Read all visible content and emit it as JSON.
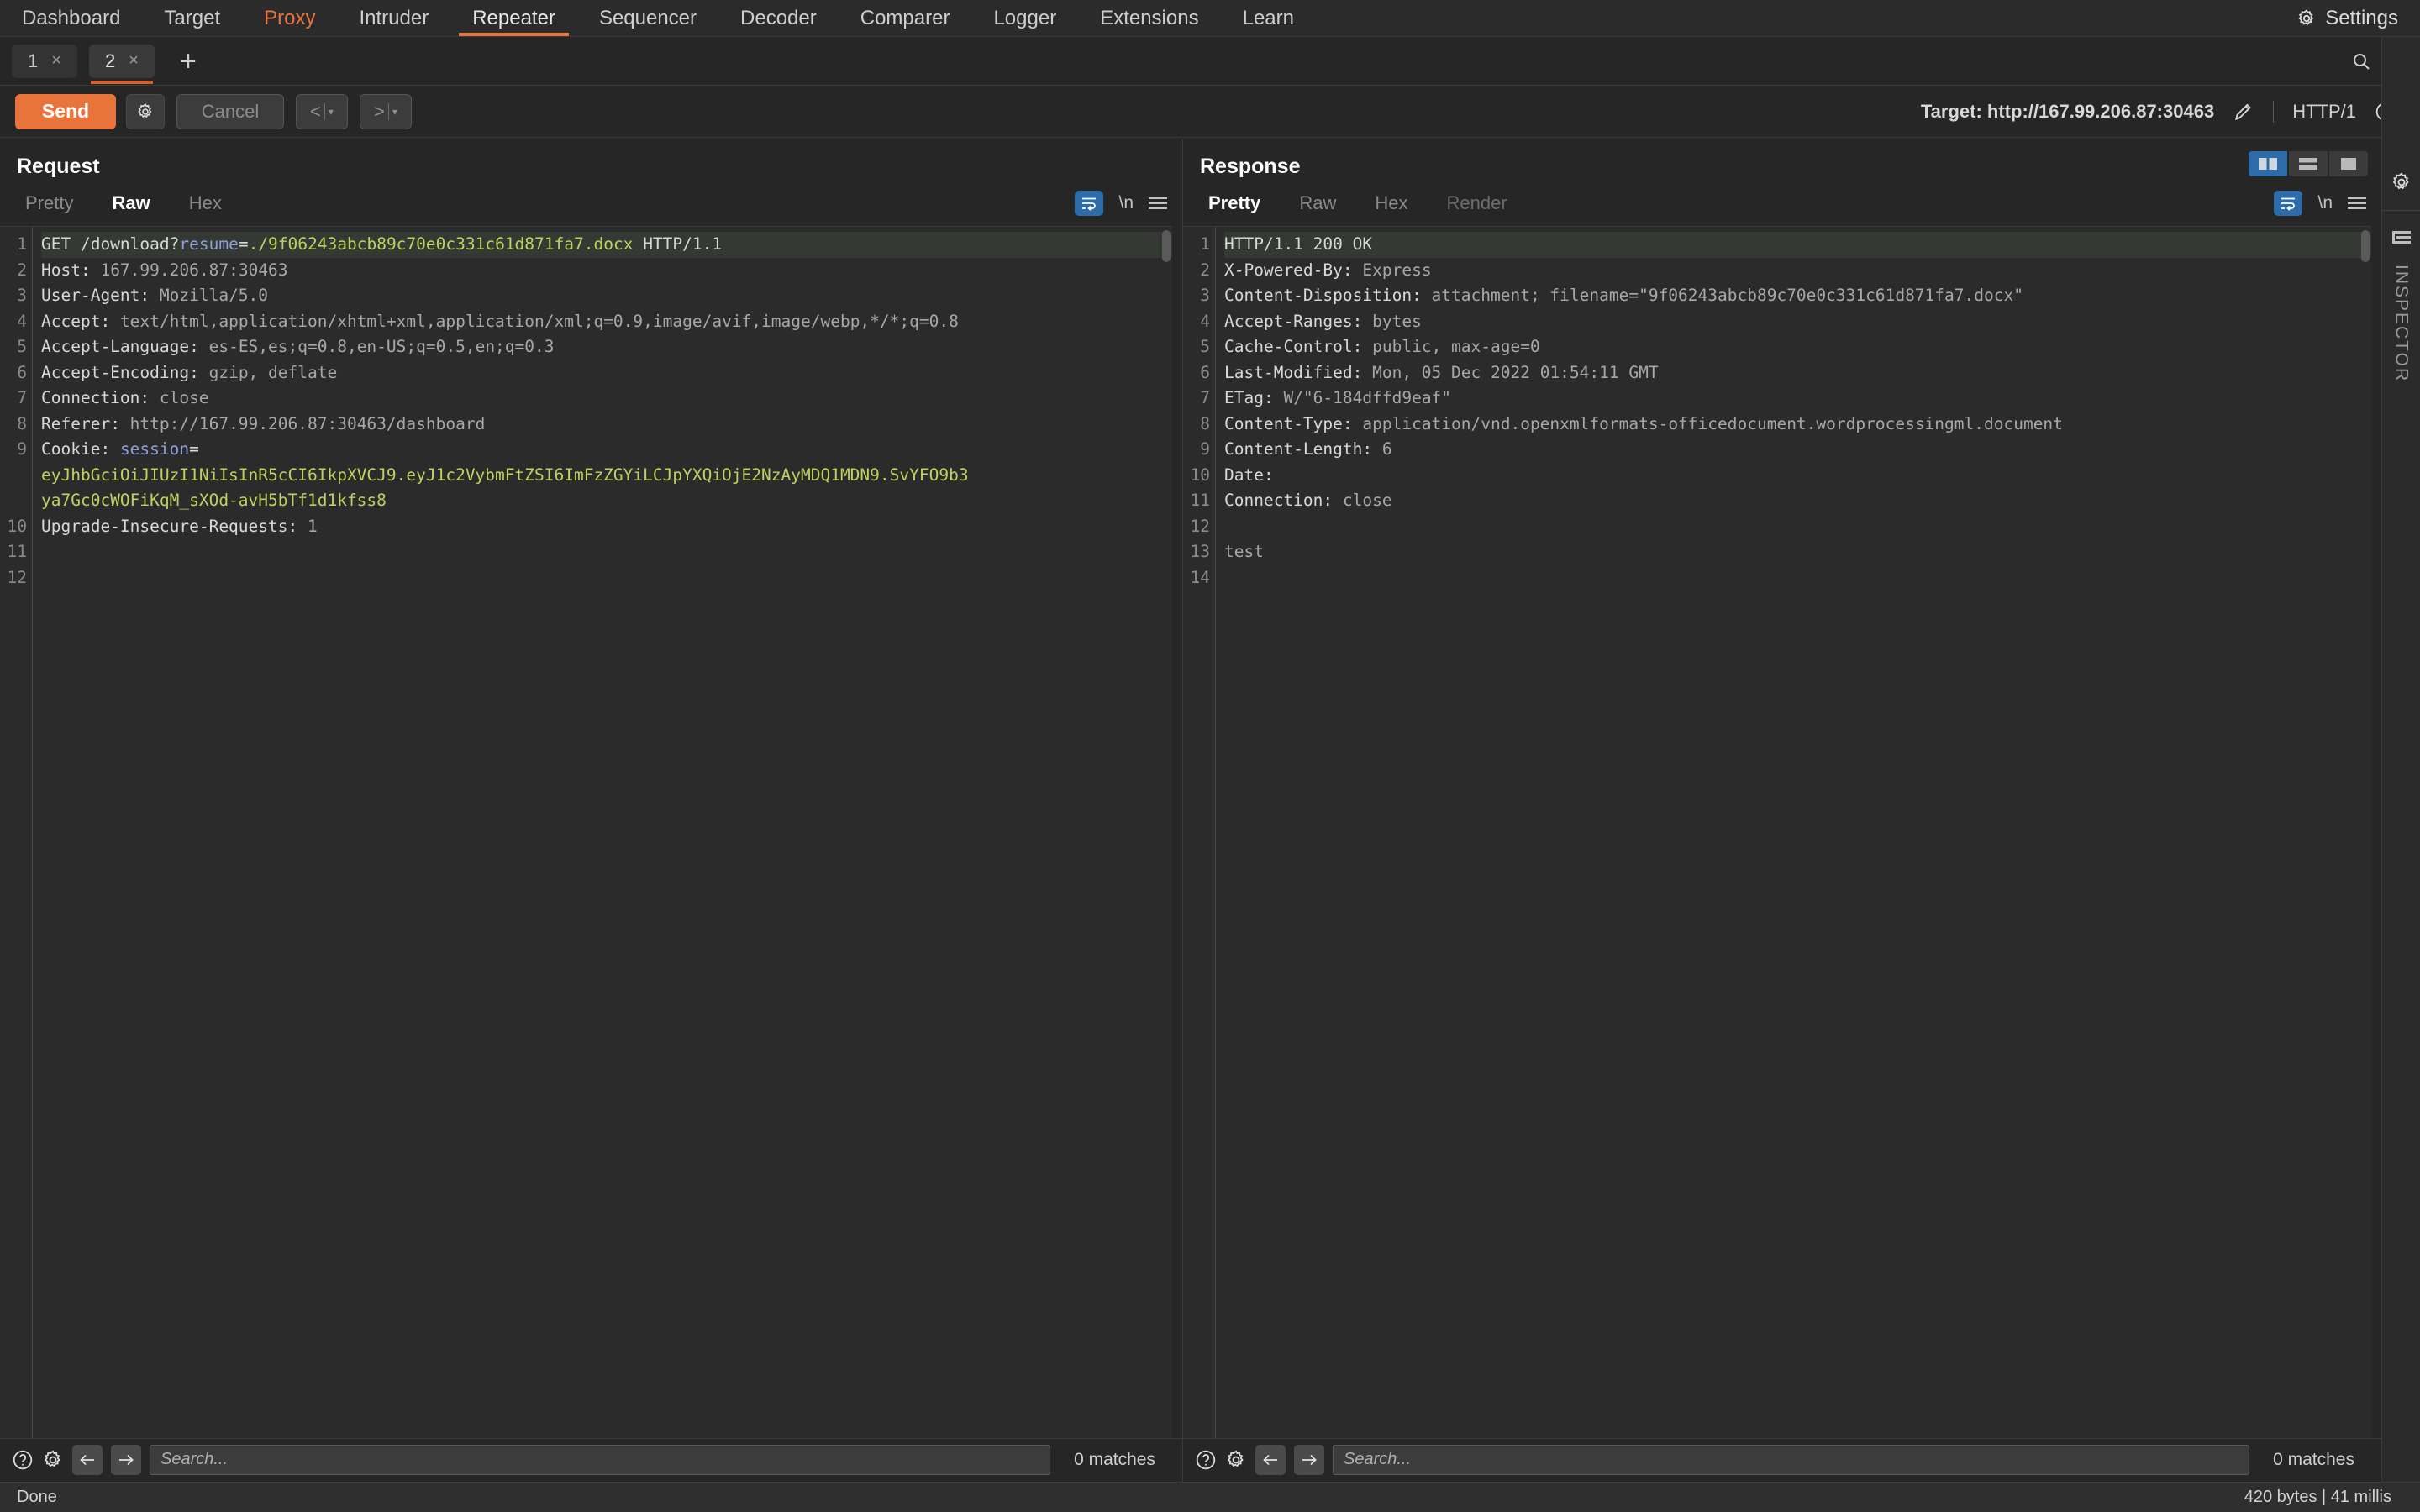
{
  "app": {
    "nav_tabs": [
      {
        "label": "Dashboard",
        "state": "normal"
      },
      {
        "label": "Target",
        "state": "normal"
      },
      {
        "label": "Proxy",
        "state": "alert"
      },
      {
        "label": "Intruder",
        "state": "normal"
      },
      {
        "label": "Repeater",
        "state": "active"
      },
      {
        "label": "Sequencer",
        "state": "normal"
      },
      {
        "label": "Decoder",
        "state": "normal"
      },
      {
        "label": "Comparer",
        "state": "normal"
      },
      {
        "label": "Logger",
        "state": "normal"
      },
      {
        "label": "Extensions",
        "state": "normal"
      },
      {
        "label": "Learn",
        "state": "normal"
      }
    ],
    "settings_label": "Settings",
    "accent_color": "#e8743b",
    "highlight_color": "#2d6ca8"
  },
  "repeater_tabs": {
    "tabs": [
      {
        "label": "1",
        "close": "×",
        "active": false
      },
      {
        "label": "2",
        "close": "×",
        "active": true
      }
    ],
    "add_label": "+"
  },
  "toolbar": {
    "send_label": "Send",
    "cancel_label": "Cancel",
    "back_label": "<",
    "forward_label": ">",
    "caret": "▾",
    "target_label": "Target: http://167.99.206.87:30463",
    "http_version": "HTTP/1"
  },
  "request": {
    "title": "Request",
    "tabs": [
      {
        "label": "Pretty",
        "active": false
      },
      {
        "label": "Raw",
        "active": true
      },
      {
        "label": "Hex",
        "active": false
      }
    ],
    "newline_label": "\\n",
    "line_numbers": [
      "1",
      "2",
      "3",
      "4",
      "5",
      "6",
      "7",
      "8",
      "9",
      "",
      "",
      "10",
      "11",
      "12"
    ],
    "lines": [
      {
        "highlight": true,
        "parts": [
          {
            "text": "GET /download?",
            "cls": "k"
          },
          {
            "text": "resume",
            "cls": "b"
          },
          {
            "text": "=",
            "cls": "k"
          },
          {
            "text": "./9f06243abcb89c70e0c331c61d871fa7.docx",
            "cls": "g"
          },
          {
            "text": " HTTP/1.1",
            "cls": "k"
          }
        ]
      },
      {
        "highlight": false,
        "parts": [
          {
            "text": "Host",
            "cls": "k"
          },
          {
            "text": ": ",
            "cls": "k"
          },
          {
            "text": "167.99.206.87:30463",
            "cls": "v"
          }
        ]
      },
      {
        "highlight": false,
        "parts": [
          {
            "text": "User-Agent",
            "cls": "k"
          },
          {
            "text": ": ",
            "cls": "k"
          },
          {
            "text": "Mozilla/5.0",
            "cls": "v"
          }
        ]
      },
      {
        "highlight": false,
        "parts": [
          {
            "text": "Accept",
            "cls": "k"
          },
          {
            "text": ": ",
            "cls": "k"
          },
          {
            "text": "text/html,application/xhtml+xml,application/xml;q=0.9,image/avif,image/webp,*/*;q=0.8",
            "cls": "v"
          }
        ]
      },
      {
        "highlight": false,
        "parts": [
          {
            "text": "Accept-Language",
            "cls": "k"
          },
          {
            "text": ": ",
            "cls": "k"
          },
          {
            "text": "es-ES,es;q=0.8,en-US;q=0.5,en;q=0.3",
            "cls": "v"
          }
        ]
      },
      {
        "highlight": false,
        "parts": [
          {
            "text": "Accept-Encoding",
            "cls": "k"
          },
          {
            "text": ": ",
            "cls": "k"
          },
          {
            "text": "gzip, deflate",
            "cls": "v"
          }
        ]
      },
      {
        "highlight": false,
        "parts": [
          {
            "text": "Connection",
            "cls": "k"
          },
          {
            "text": ": ",
            "cls": "k"
          },
          {
            "text": "close",
            "cls": "v"
          }
        ]
      },
      {
        "highlight": false,
        "parts": [
          {
            "text": "Referer",
            "cls": "k"
          },
          {
            "text": ": ",
            "cls": "k"
          },
          {
            "text": "http://167.99.206.87:30463/dashboard",
            "cls": "v"
          }
        ]
      },
      {
        "highlight": false,
        "parts": [
          {
            "text": "Cookie",
            "cls": "k"
          },
          {
            "text": ": ",
            "cls": "k"
          },
          {
            "text": "session",
            "cls": "b"
          },
          {
            "text": "=",
            "cls": "k"
          }
        ]
      },
      {
        "highlight": false,
        "parts": [
          {
            "text": "eyJhbGciOiJIUzI1NiIsInR5cCI6IkpXVCJ9.eyJ1c2VybmFtZSI6ImFzZGYiLCJpYXQiOjE2NzAyMDQ1MDN9.SvYFO9b3",
            "cls": "g"
          }
        ]
      },
      {
        "highlight": false,
        "parts": [
          {
            "text": "ya7Gc0cWOFiKqM_sXOd-avH5bTf1d1kfss8",
            "cls": "g"
          }
        ]
      },
      {
        "highlight": false,
        "parts": [
          {
            "text": "Upgrade-Insecure-Requests",
            "cls": "k"
          },
          {
            "text": ": ",
            "cls": "k"
          },
          {
            "text": "1",
            "cls": "v"
          }
        ]
      },
      {
        "highlight": false,
        "parts": []
      },
      {
        "highlight": false,
        "parts": []
      }
    ],
    "search_placeholder": "Search...",
    "matches": "0 matches"
  },
  "response": {
    "title": "Response",
    "tabs": [
      {
        "label": "Pretty",
        "active": true
      },
      {
        "label": "Raw",
        "active": false
      },
      {
        "label": "Hex",
        "active": false
      },
      {
        "label": "Render",
        "active": false,
        "disabled": true
      }
    ],
    "newline_label": "\\n",
    "line_numbers": [
      "1",
      "2",
      "3",
      "4",
      "5",
      "6",
      "7",
      "8",
      "9",
      "10",
      "11",
      "12",
      "13",
      "14"
    ],
    "lines": [
      {
        "highlight": true,
        "parts": [
          {
            "text": "HTTP/1.1 200 OK",
            "cls": "k"
          }
        ]
      },
      {
        "highlight": false,
        "parts": [
          {
            "text": "X-Powered-By",
            "cls": "k"
          },
          {
            "text": ": ",
            "cls": "k"
          },
          {
            "text": "Express",
            "cls": "v"
          }
        ]
      },
      {
        "highlight": false,
        "parts": [
          {
            "text": "Content-Disposition",
            "cls": "k"
          },
          {
            "text": ": ",
            "cls": "k"
          },
          {
            "text": "attachment; filename=\"9f06243abcb89c70e0c331c61d871fa7.docx\"",
            "cls": "v"
          }
        ]
      },
      {
        "highlight": false,
        "parts": [
          {
            "text": "Accept-Ranges",
            "cls": "k"
          },
          {
            "text": ": ",
            "cls": "k"
          },
          {
            "text": "bytes",
            "cls": "v"
          }
        ]
      },
      {
        "highlight": false,
        "parts": [
          {
            "text": "Cache-Control",
            "cls": "k"
          },
          {
            "text": ": ",
            "cls": "k"
          },
          {
            "text": "public, max-age=0",
            "cls": "v"
          }
        ]
      },
      {
        "highlight": false,
        "parts": [
          {
            "text": "Last-Modified",
            "cls": "k"
          },
          {
            "text": ": ",
            "cls": "k"
          },
          {
            "text": "Mon, 05 Dec 2022 01:54:11 GMT",
            "cls": "v"
          }
        ]
      },
      {
        "highlight": false,
        "parts": [
          {
            "text": "ETag",
            "cls": "k"
          },
          {
            "text": ": ",
            "cls": "k"
          },
          {
            "text": "W/\"6-184dffd9eaf\"",
            "cls": "v"
          }
        ]
      },
      {
        "highlight": false,
        "parts": [
          {
            "text": "Content-Type",
            "cls": "k"
          },
          {
            "text": ": ",
            "cls": "k"
          },
          {
            "text": "application/vnd.openxmlformats-officedocument.wordprocessingml.document",
            "cls": "v"
          }
        ]
      },
      {
        "highlight": false,
        "parts": [
          {
            "text": "Content-Length",
            "cls": "k"
          },
          {
            "text": ": ",
            "cls": "k"
          },
          {
            "text": "6",
            "cls": "v"
          }
        ]
      },
      {
        "highlight": false,
        "parts": [
          {
            "text": "Date",
            "cls": "k"
          },
          {
            "text": ":",
            "cls": "k"
          }
        ]
      },
      {
        "highlight": false,
        "parts": [
          {
            "text": "Connection",
            "cls": "k"
          },
          {
            "text": ": ",
            "cls": "k"
          },
          {
            "text": "close",
            "cls": "v"
          }
        ]
      },
      {
        "highlight": false,
        "parts": []
      },
      {
        "highlight": false,
        "parts": [
          {
            "text": "test",
            "cls": "v"
          }
        ]
      },
      {
        "highlight": false,
        "parts": []
      }
    ],
    "search_placeholder": "Search...",
    "matches": "0 matches",
    "layout_modes": [
      "side-by-side",
      "stacked",
      "single"
    ]
  },
  "inspector": {
    "label": "INSPECTOR"
  },
  "statusbar": {
    "left": "Done",
    "right": "420 bytes | 41 millis"
  }
}
